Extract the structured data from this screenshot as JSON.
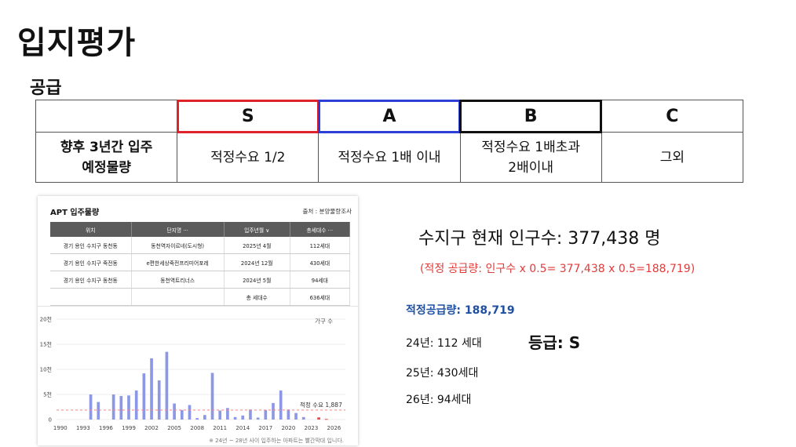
{
  "title": "입지평가",
  "subtitle": "공급",
  "grade_table": {
    "headers": [
      "",
      "S",
      "A",
      "B",
      "C"
    ],
    "row_label": "향후 3년간 입주\n예정물량",
    "cells": [
      "적정수요 1/2",
      "적정수요 1배 이내",
      "적정수요 1배초과\n2배이내",
      "그외"
    ],
    "colors": {
      "S": "#e0222b",
      "A": "#2d3fd6",
      "B": "#111111"
    }
  },
  "apt_panel": {
    "title": "APT 입주물량",
    "source": "출처 : 분양물량조사",
    "columns": [
      "위치",
      "단지명 ···",
      "입주년월 ∨",
      "총세대수 ···"
    ],
    "rows": [
      [
        "경기 용인 수지구 동천동",
        "동천역자이르네(도시형)",
        "2025년 4월",
        "112세대"
      ],
      [
        "경기 용인 수지구 죽전동",
        "e편한세상죽전프리미어포레",
        "2024년 12월",
        "430세대"
      ],
      [
        "경기 용인 수지구 동천동",
        "동천역트리너스",
        "2024년 5월",
        "94세대"
      ]
    ],
    "total_label": "총 세대수",
    "total_value": "636세대"
  },
  "chart_data": {
    "type": "bar",
    "legend_label": "가구 수",
    "demand_label": "적정 수요 1,887",
    "demand_value": 1887,
    "footnote": "※ 24년 ~ 28년 사이 입주하는 아파트는 빨간막대 입니다.",
    "y_ticks": [
      "0",
      "5천",
      "10천",
      "15천",
      "20천"
    ],
    "y_values": [
      0,
      5000,
      10000,
      15000,
      20000
    ],
    "x_ticks": [
      "1990",
      "1993",
      "1996",
      "1999",
      "2002",
      "2005",
      "2008",
      "2011",
      "2014",
      "2017",
      "2020",
      "2023",
      "2026"
    ],
    "ylim": [
      0,
      20000
    ],
    "x": [
      1994,
      1995,
      1997,
      1998,
      1999,
      2000,
      2001,
      2002,
      2003,
      2004,
      2005,
      2006,
      2007,
      2008,
      2009,
      2010,
      2011,
      2012,
      2013,
      2014,
      2015,
      2016,
      2017,
      2018,
      2019,
      2020,
      2021,
      2022,
      2024,
      2025
    ],
    "values": [
      5000,
      3500,
      5000,
      4700,
      4800,
      5800,
      9200,
      12200,
      7800,
      13500,
      3200,
      1900,
      2900,
      300,
      900,
      9300,
      1800,
      2300,
      500,
      800,
      2000,
      400,
      1900,
      3300,
      5800,
      2000,
      1300,
      500,
      430,
      112
    ],
    "highlight_years": [
      2024,
      2025
    ],
    "bar_color": "#8c98e6",
    "highlight_color": "#e34b4b"
  },
  "population_text": "수지구 현재 인구수: 377,438 명",
  "formula_text": "(적정 공급량: 인구수 x 0.5= 377,438 x 0.5=188,719)",
  "supply_label": "적정공급량: ",
  "supply_value": "188,719",
  "years": [
    "24년: 112 세대",
    "25년: 430세대",
    "26년: 94세대"
  ],
  "grade_result": "등급: S"
}
